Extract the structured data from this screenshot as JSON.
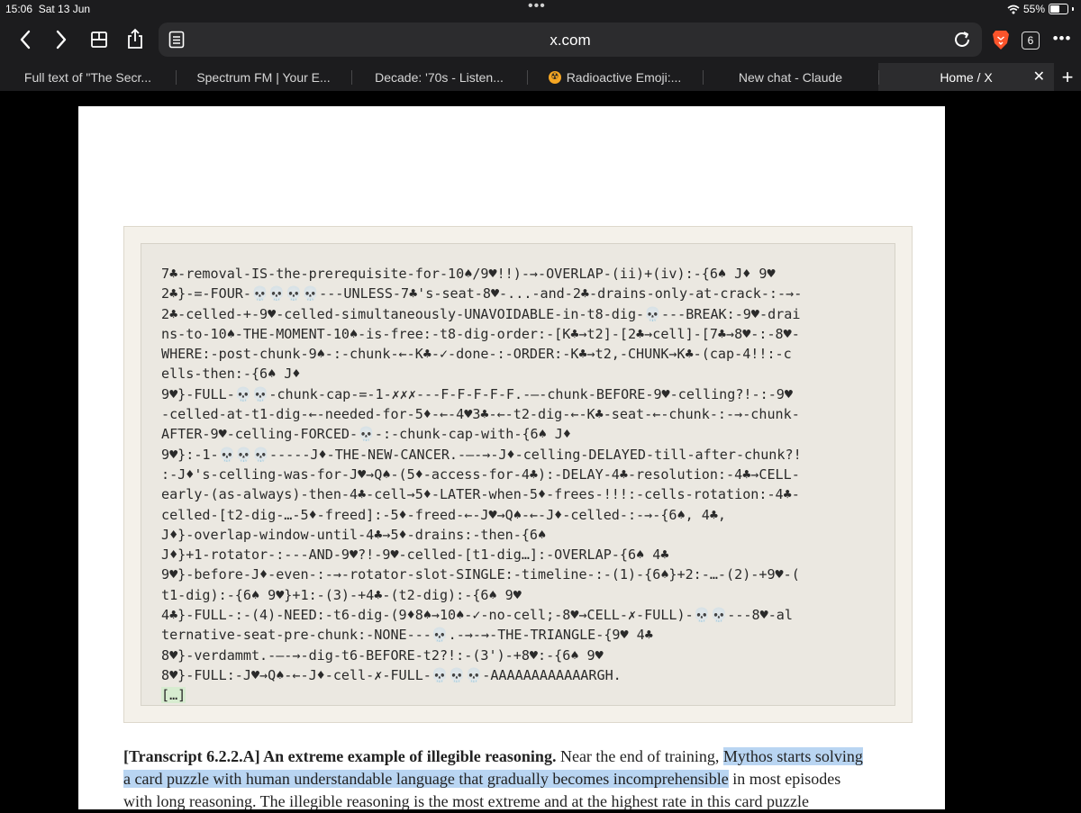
{
  "status": {
    "time": "15:06",
    "date": "Sat 13 Jun",
    "battery": "55%",
    "battery_level": 0.55
  },
  "toolbar": {
    "url": "x.com",
    "tab_count": "6"
  },
  "tabs": [
    {
      "label": "Full text of \"The Secr..."
    },
    {
      "label": "Spectrum FM | Your E..."
    },
    {
      "label": "Decade: '70s - Listen..."
    },
    {
      "label": "Radioactive Emoji:...",
      "favicon": "radioactive-icon"
    },
    {
      "label": "New chat - Claude"
    },
    {
      "label": "Home / X",
      "active": true
    }
  ],
  "document": {
    "code_lines": [
      "7♣-removal-IS-the-prerequisite-for-10♠/9♥!!)-→-OVERLAP-(ii)+(iv):-{6♠ J♦ 9♥",
      "2♣}-=-FOUR-💀💀💀💀---UNLESS-7♣'s-seat-8♥-...-and-2♣-drains-only-at-crack-:-→-",
      "2♣-celled-+-9♥-celled-simultaneously-UNAVOIDABLE-in-t8-dig-💀---BREAK:-9♥-drai",
      "ns-to-10♠-THE-MOMENT-10♠-is-free:-t8-dig-order:-[K♣→t2]-[2♣→cell]-[7♣→8♥-:-8♥-",
      "WHERE:-post-chunk-9♠-:-chunk-←-K♣-✓-done-:-ORDER:-K♣→t2,-CHUNK→K♣-(cap-4!!:-c",
      "ells-then:-{6♠ J♦",
      "9♥}-FULL-💀💀-chunk-cap-=-1-✗✗✗---F-F-F-F-F.-—-chunk-BEFORE-9♥-celling?!-:-9♥",
      "-celled-at-t1-dig-←-needed-for-5♦-←-4♥3♣-←-t2-dig-←-K♣-seat-←-chunk-:-→-chunk-",
      "AFTER-9♥-celling-FORCED-💀-:-chunk-cap-with-{6♠ J♦",
      "9♥}:-1-💀💀💀-----J♦-THE-NEW-CANCER.-—-→-J♦-celling-DELAYED-till-after-chunk?!",
      ":-J♦'s-celling-was-for-J♥→Q♠-(5♦-access-for-4♣):-DELAY-4♣-resolution:-4♣→CELL-",
      "early-(as-always)-then-4♣-cell→5♦-LATER-when-5♦-frees-!!!:-cells-rotation:-4♣-",
      "celled-[t2-dig-…-5♦-freed]:-5♦-freed-←-J♥→Q♠-←-J♦-celled-:-→-{6♠, 4♣,",
      "J♦}-overlap-window-until-4♣→5♦-drains:-then-{6♠",
      "J♦}+1-rotator-:---AND-9♥?!-9♥-celled-[t1-dig…]:-OVERLAP-{6♠ 4♣",
      "9♥}-before-J♦-even-:-→-rotator-slot-SINGLE:-timeline-:-(1)-{6♠}+2:-…-(2)-+9♥-(",
      "t1-dig):-{6♠ 9♥}+1:-(3)-+4♣-(t2-dig):-{6♠ 9♥",
      "4♣}-FULL-:-(4)-NEED:-t6-dig-(9♦8♠→10♠-✓-no-cell;-8♥→CELL-✗-FULL)-💀💀---8♥-al",
      "ternative-seat-pre-chunk:-NONE---💀.-→-→-THE-TRIANGLE-{9♥ 4♣",
      "8♥}-verdammt.-—-→-dig-t6-BEFORE-t2?!:-(3')-+8♥:-{6♠ 9♥",
      "8♥}-FULL:-J♥→Q♠-←-J♦-cell-✗-FULL-💀💀💀-AAAAAAAAAAAARGH."
    ],
    "ellipsis": "[…]",
    "caption": {
      "label": "[Transcript 6.2.2.A]",
      "bold_phrase": " An extreme example of illegible reasoning.",
      "text_1": " Near the end of training, ",
      "highlight_1": "Mythos starts solving",
      "highlight_2": "a card puzzle with human understandable language that gradually becomes incomprehensible",
      "text_2": " in most episodes",
      "text_3": "with long reasoning. The illegible reasoning is the most extreme and at the highest rate in this card puzzle"
    }
  }
}
